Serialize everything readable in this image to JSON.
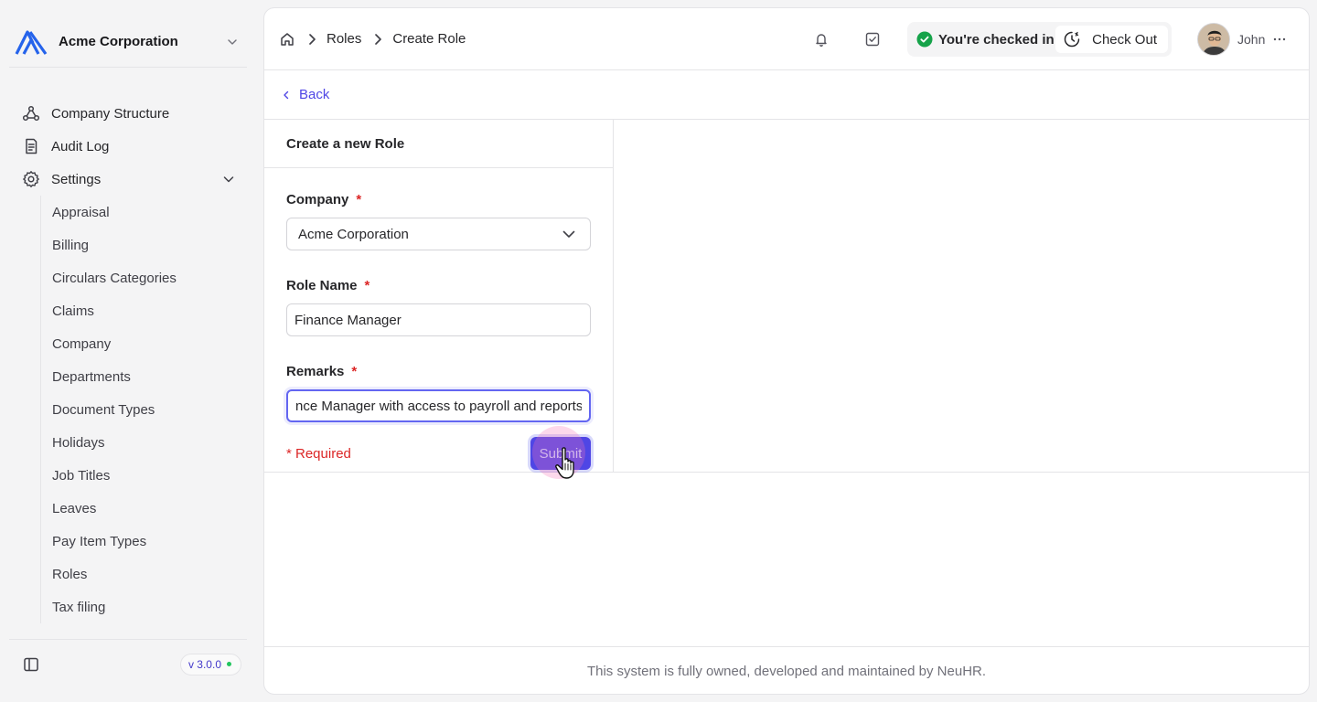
{
  "brand": {
    "name": "Acme Corporation",
    "logo_icon": "acme-logo",
    "accent": "#2563eb"
  },
  "sidebar": {
    "items": [
      {
        "label": "Company Structure",
        "icon": "org-structure-icon"
      },
      {
        "label": "Audit Log",
        "icon": "document-list-icon"
      },
      {
        "label": "Settings",
        "icon": "gear-icon"
      }
    ],
    "settings_children": [
      "Appraisal",
      "Billing",
      "Circulars Categories",
      "Claims",
      "Company",
      "Departments",
      "Document Types",
      "Holidays",
      "Job Titles",
      "Leaves",
      "Pay Item Types",
      "Roles",
      "Tax filing"
    ],
    "version": "v 3.0.0"
  },
  "breadcrumb": {
    "parent": "Roles",
    "current": "Create Role"
  },
  "header": {
    "checkin_status": "You're checked in",
    "checkout_label": "Check Out",
    "user_name": "John"
  },
  "back_label": "Back",
  "form": {
    "title": "Create a new Role",
    "company_label": "Company",
    "company_value": "Acme Corporation",
    "role_name_label": "Role Name",
    "role_name_value": "Finance Manager",
    "remarks_label": "Remarks",
    "remarks_value": "nce Manager with access to payroll and reports.",
    "required_asterisk": "*",
    "required_note": "* Required",
    "submit_label": "Submit"
  },
  "footer_text": "This system is fully owned, developed and maintained by NeuHR.",
  "colors": {
    "primary": "#4f46e5",
    "required": "#dc2626",
    "success": "#16a34a"
  }
}
